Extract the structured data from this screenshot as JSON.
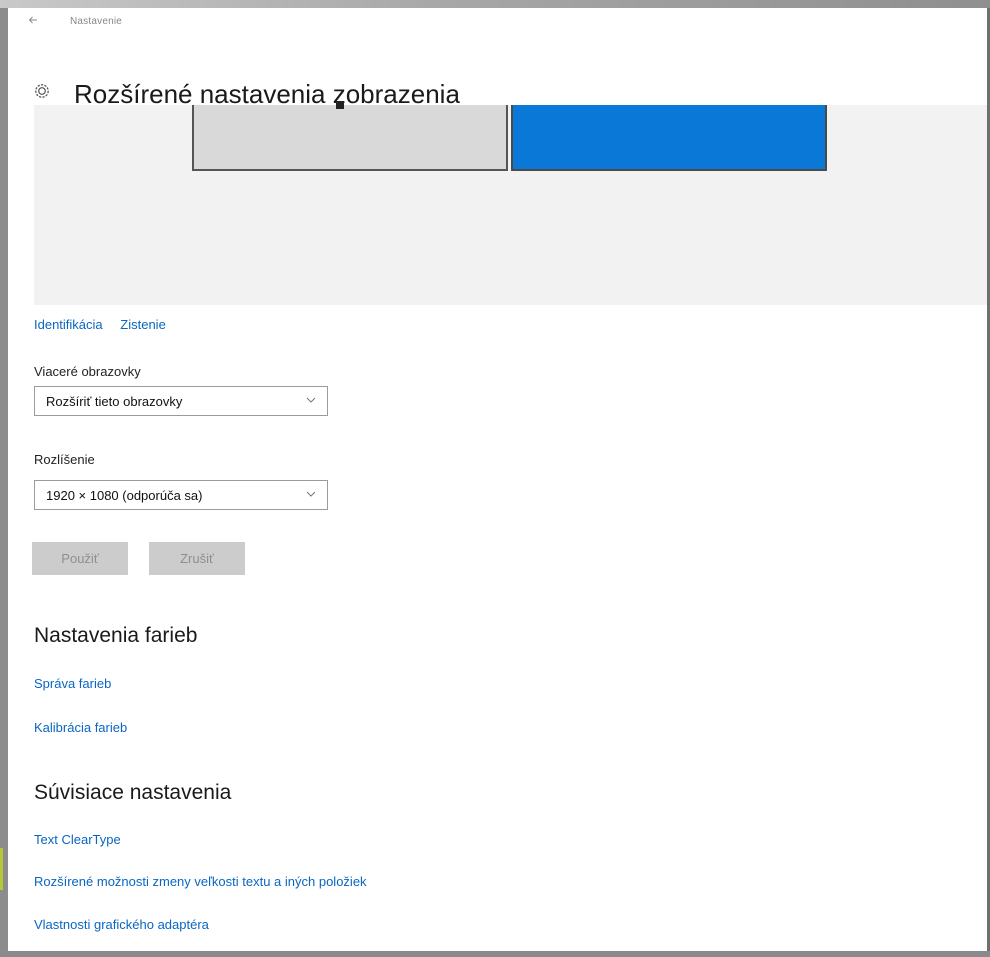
{
  "window": {
    "title": "Nastavenie",
    "back_icon": "back-arrow-icon"
  },
  "page": {
    "title": "Rozšírené nastavenia zobrazenia",
    "icon": "gear-icon"
  },
  "display_area": {
    "monitors": [
      {
        "name": "monitor-1",
        "state": "inactive",
        "color": "#d9d9d9"
      },
      {
        "name": "monitor-2",
        "state": "selected",
        "color": "#0a78d6"
      }
    ]
  },
  "links": {
    "identify": "Identifikácia",
    "detect": "Zistenie"
  },
  "multiple_displays": {
    "label": "Viaceré obrazovky",
    "value": "Rozšíriť tieto obrazovky"
  },
  "resolution": {
    "label": "Rozlíšenie",
    "value": "1920 × 1080 (odporúča sa)"
  },
  "buttons": {
    "apply": "Použiť",
    "cancel": "Zrušiť"
  },
  "color_settings": {
    "heading": "Nastavenia farieb",
    "links": [
      "Správa farieb",
      "Kalibrácia farieb"
    ]
  },
  "related_settings": {
    "heading": "Súvisiace nastavenia",
    "links": [
      "Text ClearType",
      "Rozšírené možnosti zmeny veľkosti textu a iných položiek",
      "Vlastnosti grafického adaptéra"
    ]
  },
  "colors": {
    "accent": "#0a78d6",
    "link": "#0a66c2",
    "disabled_button": "#cccccc"
  }
}
